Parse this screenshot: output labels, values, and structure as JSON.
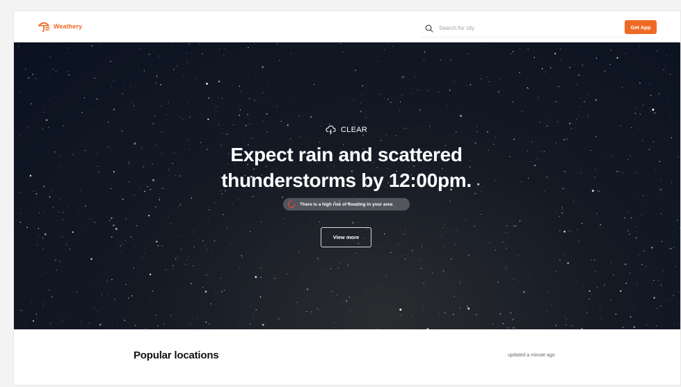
{
  "header": {
    "brand": "Weathery",
    "search_placeholder": "Search for city",
    "cta_label": "Get App"
  },
  "hero": {
    "condition": "CLEAR",
    "headline_line1": "Expect rain and scattered",
    "headline_line2": "thunderstorms by 12:00pm.",
    "alert": "There is a high risk of flooding in your area",
    "button_label": "View more"
  },
  "popular": {
    "title": "Popular locations",
    "updated": "updated a minute ago"
  },
  "colors": {
    "accent": "#ee6a24",
    "hero_bg": "#0b1220",
    "alert_icon": "#e0453c"
  },
  "icons": {
    "logo": "umbrella-wind-icon",
    "search": "search-icon",
    "condition": "cloud-lightning-icon",
    "alert": "warning-icon"
  }
}
